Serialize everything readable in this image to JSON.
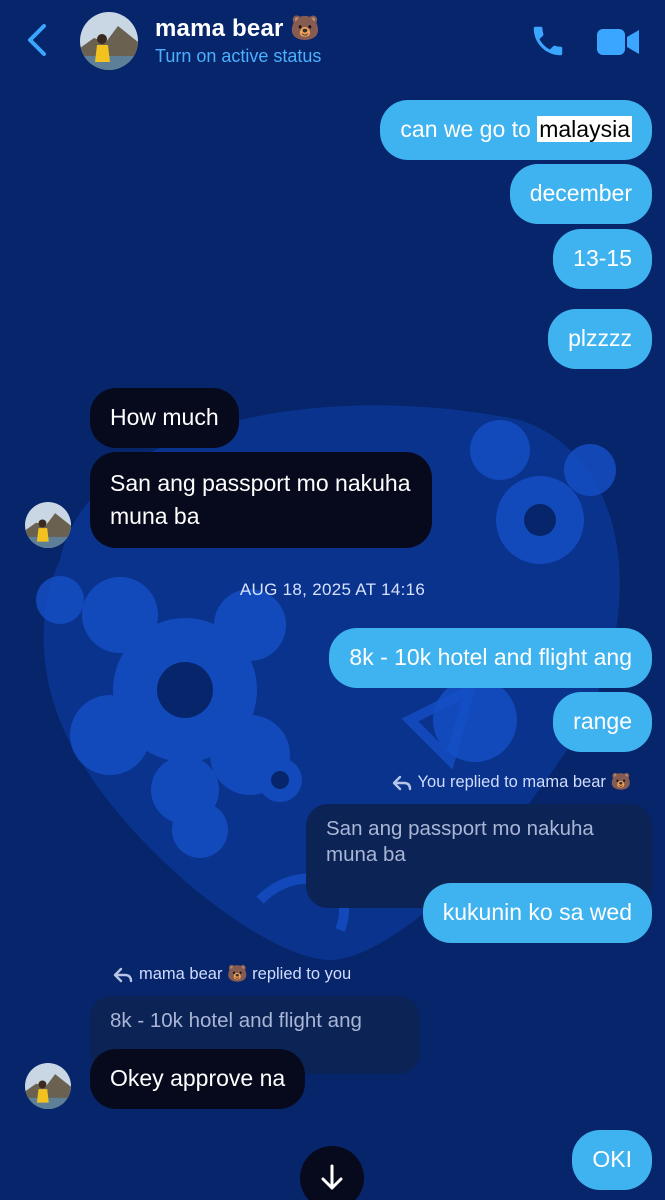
{
  "header": {
    "contact_name": "mama bear 🐻",
    "active_status": "Turn on active status"
  },
  "icons": {
    "back": "chevron-left-icon",
    "call": "phone-icon",
    "video": "video-camera-icon",
    "reply": "reply-arrow-icon",
    "scroll": "arrow-down-icon"
  },
  "colors": {
    "background": "#06256a",
    "outgoing_bubble": "#3fb3ef",
    "incoming_bubble": "#070a1c",
    "accent": "#4cb0ff"
  },
  "messages": {
    "m1_before": "can we go to ",
    "m1_highlight": "malaysia",
    "m2": "december",
    "m3": "13-15",
    "m4": "plzzzz",
    "m5": "How much",
    "m6_line1": "San ang passport mo nakuha",
    "m6_line2": "muna ba",
    "timestamp": "AUG 18, 2025 AT 14:16",
    "m7": "8k - 10k hotel and flight ang",
    "m8": "range",
    "reply1_note": "You replied to mama bear 🐻",
    "reply1_quote_line1": "San ang passport mo nakuha",
    "reply1_quote_line2": "muna ba",
    "m9": "kukunin ko sa wed",
    "reply2_note": "mama bear 🐻  replied to you",
    "reply2_quote": "8k - 10k hotel and flight ang",
    "m10": "Okey approve na",
    "m11": "OKI"
  }
}
